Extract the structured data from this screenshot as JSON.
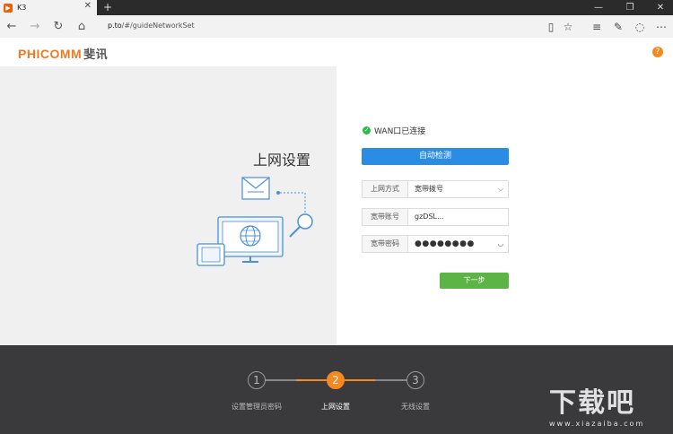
{
  "browser": {
    "tab_title": "K3",
    "tab_close": "✕",
    "new_tab": "+",
    "url_host": "p.to",
    "url_path": "/#/guideNetworkSet",
    "window_controls": {
      "minimize": "—",
      "restore": "❐",
      "close": "✕"
    }
  },
  "header": {
    "logo_en": "PHICOMM",
    "logo_cn": "斐讯",
    "help_label": "?"
  },
  "content": {
    "page_title": "上网设置",
    "wan_status": "WAN口已连接",
    "detect_button": "自动检测",
    "fields": [
      {
        "label": "上网方式",
        "value": "宽带拨号"
      },
      {
        "label": "宽带账号",
        "value": "gzDSL..."
      },
      {
        "label": "宽带密码",
        "value": "●●●●●●●●"
      }
    ],
    "next_button": "下一步"
  },
  "stepper": {
    "steps": [
      {
        "number": "1",
        "label": "设置管理员密码"
      },
      {
        "number": "2",
        "label": "上网设置"
      },
      {
        "number": "3",
        "label": "无线设置"
      }
    ],
    "active_step": 2
  },
  "watermark": {
    "text_cn": "下载吧",
    "text_url": "www.xiazaiba.com"
  },
  "colors": {
    "brand_orange": "#f37920",
    "primary_blue": "#2a8de3",
    "success_green": "#5cb346",
    "status_green": "#2fb84e",
    "footer_bg": "#3a3a3c"
  }
}
